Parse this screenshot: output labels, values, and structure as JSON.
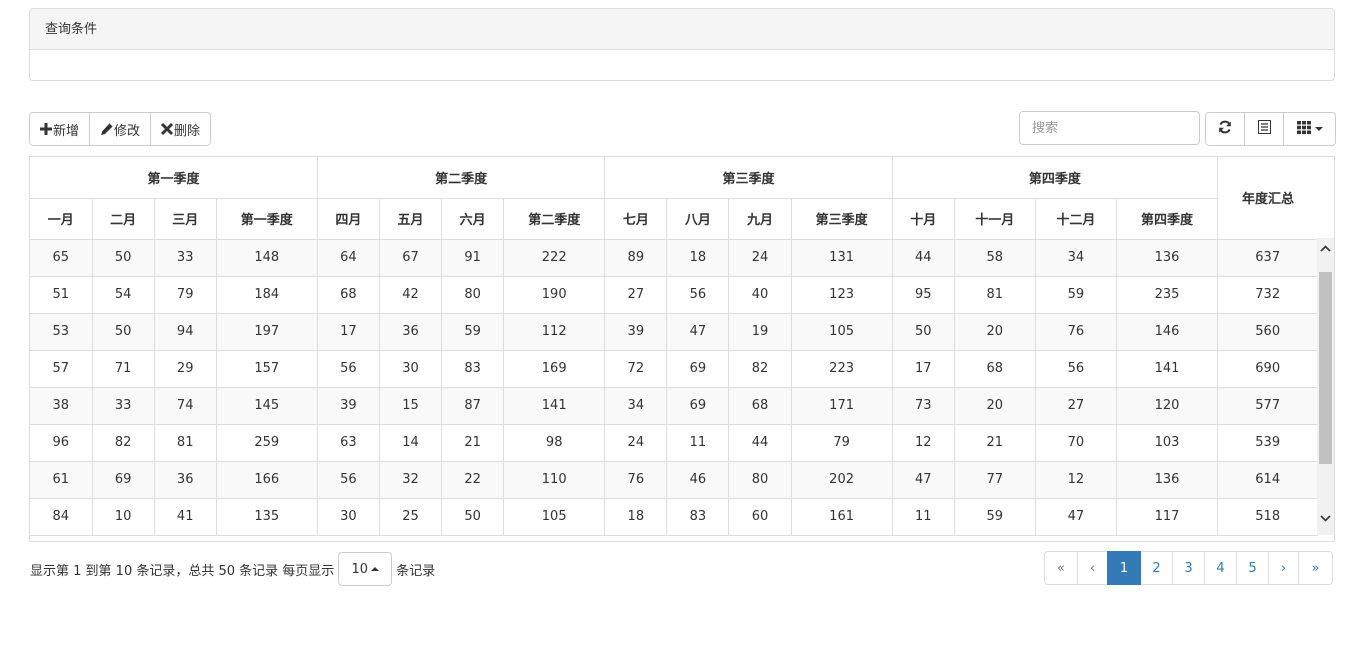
{
  "panel": {
    "title": "查询条件"
  },
  "toolbar": {
    "add_label": "新增",
    "edit_label": "修改",
    "delete_label": "删除",
    "search_placeholder": "搜索",
    "icons": [
      "refresh-icon",
      "list-icon",
      "columns-icon"
    ]
  },
  "table": {
    "groups": [
      "第一季度",
      "第二季度",
      "第三季度",
      "第四季度"
    ],
    "total_header": "年度汇总",
    "columns": [
      "一月",
      "二月",
      "三月",
      "第一季度",
      "四月",
      "五月",
      "六月",
      "第二季度",
      "七月",
      "八月",
      "九月",
      "第三季度",
      "十月",
      "十一月",
      "十二月",
      "第四季度"
    ],
    "rows": [
      [
        "65",
        "50",
        "33",
        "148",
        "64",
        "67",
        "91",
        "222",
        "89",
        "18",
        "24",
        "131",
        "44",
        "58",
        "34",
        "136",
        "637"
      ],
      [
        "51",
        "54",
        "79",
        "184",
        "68",
        "42",
        "80",
        "190",
        "27",
        "56",
        "40",
        "123",
        "95",
        "81",
        "59",
        "235",
        "732"
      ],
      [
        "53",
        "50",
        "94",
        "197",
        "17",
        "36",
        "59",
        "112",
        "39",
        "47",
        "19",
        "105",
        "50",
        "20",
        "76",
        "146",
        "560"
      ],
      [
        "57",
        "71",
        "29",
        "157",
        "56",
        "30",
        "83",
        "169",
        "72",
        "69",
        "82",
        "223",
        "17",
        "68",
        "56",
        "141",
        "690"
      ],
      [
        "38",
        "33",
        "74",
        "145",
        "39",
        "15",
        "87",
        "141",
        "34",
        "69",
        "68",
        "171",
        "73",
        "20",
        "27",
        "120",
        "577"
      ],
      [
        "96",
        "82",
        "81",
        "259",
        "63",
        "14",
        "21",
        "98",
        "24",
        "11",
        "44",
        "79",
        "12",
        "21",
        "70",
        "103",
        "539"
      ],
      [
        "61",
        "69",
        "36",
        "166",
        "56",
        "32",
        "22",
        "110",
        "76",
        "46",
        "80",
        "202",
        "47",
        "77",
        "12",
        "136",
        "614"
      ],
      [
        "84",
        "10",
        "41",
        "135",
        "30",
        "25",
        "50",
        "105",
        "18",
        "83",
        "60",
        "161",
        "11",
        "59",
        "47",
        "117",
        "518"
      ]
    ]
  },
  "pagination": {
    "info_prefix": "显示第 1 到第 10 条记录，总共 50 条记录 每页显示",
    "page_size": "10",
    "info_suffix": "条记录",
    "first": "«",
    "prev": "‹",
    "pages": [
      "1",
      "2",
      "3",
      "4",
      "5"
    ],
    "active_page": "1",
    "next": "›",
    "last": "»"
  },
  "colors": {
    "primary": "#337ab7",
    "border": "#ddd",
    "stripe": "#f9f9f9"
  }
}
